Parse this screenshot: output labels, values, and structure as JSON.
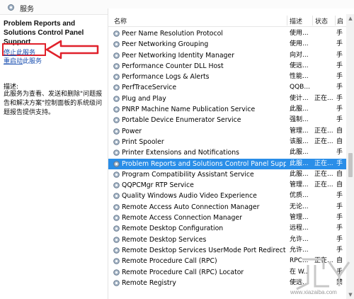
{
  "window": {
    "title": "服务"
  },
  "left_panel": {
    "service_title": "Problem Reports and Solutions Control Panel Support",
    "stop_link_underlined": "停止",
    "stop_link_rest": "此服务",
    "restart_link_underlined": "重启动",
    "restart_link_rest": "此服务",
    "description_label": "描述:",
    "description_text": "此服务为查看、发送和删除\"问题报告和解决方案\"控制面板的系统级问题报告提供支持。"
  },
  "list": {
    "columns": {
      "name": "名称",
      "description": "描述",
      "status": "状态",
      "startup": "启"
    },
    "rows": [
      {
        "name": "Peer Name Resolution Protocol",
        "description": "使用...",
        "status": "",
        "startup": "手"
      },
      {
        "name": "Peer Networking Grouping",
        "description": "使用...",
        "status": "",
        "startup": "手"
      },
      {
        "name": "Peer Networking Identity Manager",
        "description": "向对...",
        "status": "",
        "startup": "手"
      },
      {
        "name": "Performance Counter DLL Host",
        "description": "使远...",
        "status": "",
        "startup": "手"
      },
      {
        "name": "Performance Logs & Alerts",
        "description": "性能...",
        "status": "",
        "startup": "手"
      },
      {
        "name": "PerfTraceService",
        "description": "QQB...",
        "status": "",
        "startup": "手"
      },
      {
        "name": "Plug and Play",
        "description": "使计...",
        "status": "正在...",
        "startup": "手"
      },
      {
        "name": "PNRP Machine Name Publication Service",
        "description": "此服...",
        "status": "",
        "startup": "手"
      },
      {
        "name": "Portable Device Enumerator Service",
        "description": "强制...",
        "status": "",
        "startup": "手"
      },
      {
        "name": "Power",
        "description": "管理...",
        "status": "正在...",
        "startup": "自"
      },
      {
        "name": "Print Spooler",
        "description": "该服...",
        "status": "正在...",
        "startup": "自"
      },
      {
        "name": "Printer Extensions and Notifications",
        "description": "此服...",
        "status": "",
        "startup": "手"
      },
      {
        "name": "Problem Reports and Solutions Control Panel Support",
        "description": "此服...",
        "status": "正在...",
        "startup": "手",
        "selected": true
      },
      {
        "name": "Program Compatibility Assistant Service",
        "description": "此服...",
        "status": "正在...",
        "startup": "自"
      },
      {
        "name": "QQPCMgr RTP Service",
        "description": "管理...",
        "status": "正在...",
        "startup": "自"
      },
      {
        "name": "Quality Windows Audio Video Experience",
        "description": "优质...",
        "status": "",
        "startup": "手"
      },
      {
        "name": "Remote Access Auto Connection Manager",
        "description": "无论...",
        "status": "",
        "startup": "手"
      },
      {
        "name": "Remote Access Connection Manager",
        "description": "管理...",
        "status": "",
        "startup": "手"
      },
      {
        "name": "Remote Desktop Configuration",
        "description": "远程...",
        "status": "",
        "startup": "手"
      },
      {
        "name": "Remote Desktop Services",
        "description": "允许...",
        "status": "",
        "startup": "手"
      },
      {
        "name": "Remote Desktop Services UserMode Port Redirector",
        "description": "允许...",
        "status": "",
        "startup": "手"
      },
      {
        "name": "Remote Procedure Call (RPC)",
        "description": "RPC...",
        "status": "正在...",
        "startup": "自"
      },
      {
        "name": "Remote Procedure Call (RPC) Locator",
        "description": "在 W...",
        "status": "",
        "startup": "手"
      },
      {
        "name": "Remote Registry",
        "description": "使远...",
        "status": "",
        "startup": "禁"
      },
      {
        "name": "",
        "description": "",
        "status": "",
        "startup": ""
      }
    ]
  },
  "watermark": {
    "text": "www.xiazaiba.com"
  },
  "colors": {
    "selection": "#2a8ee8",
    "highlight_box": "#e0212b",
    "link": "#1a4fb0"
  },
  "icons": {
    "service_row": "gear-icon",
    "window": "gear-icon"
  }
}
